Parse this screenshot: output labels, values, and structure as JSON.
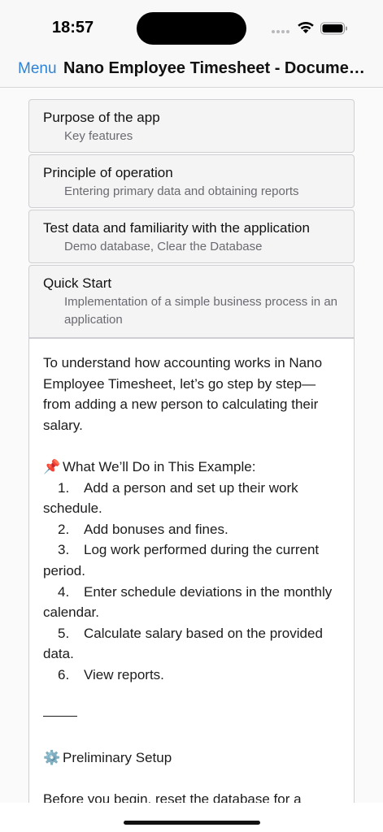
{
  "status_bar": {
    "time": "18:57"
  },
  "nav": {
    "menu_label": "Menu",
    "title": "Nano Employee Timesheet - Documentation"
  },
  "sections": [
    {
      "title": "Purpose of the app",
      "subtitle": "Key features"
    },
    {
      "title": "Principle of operation",
      "subtitle": "Entering primary data and obtaining reports"
    },
    {
      "title": "Test data and familiarity with the application",
      "subtitle": "Demo database, Clear the Database"
    },
    {
      "title": "Quick Start",
      "subtitle": "Implementation of a simple business process in an application"
    }
  ],
  "article": {
    "intro": "To understand how accounting works in Nano Employee Timesheet, let’s go step by step—from adding a new person to calculating their salary.",
    "example_heading_emoji": "📌",
    "example_heading": "What We’ll Do in This Example:",
    "steps": [
      {
        "num": "1.",
        "text": "Add a person and set up their work schedule."
      },
      {
        "num": "2.",
        "text": "Add bonuses and fines."
      },
      {
        "num": "3.",
        "text": "Log work performed during the current period."
      },
      {
        "num": "4.",
        "text": "Enter schedule deviations in the monthly calendar."
      },
      {
        "num": "5.",
        "text": "Calculate salary based on the provided data."
      },
      {
        "num": "6.",
        "text": "View reports."
      }
    ],
    "setup_emoji": "⚙️",
    "setup_heading": "Preliminary Setup",
    "setup_text": "Before you begin, reset the database for a"
  }
}
